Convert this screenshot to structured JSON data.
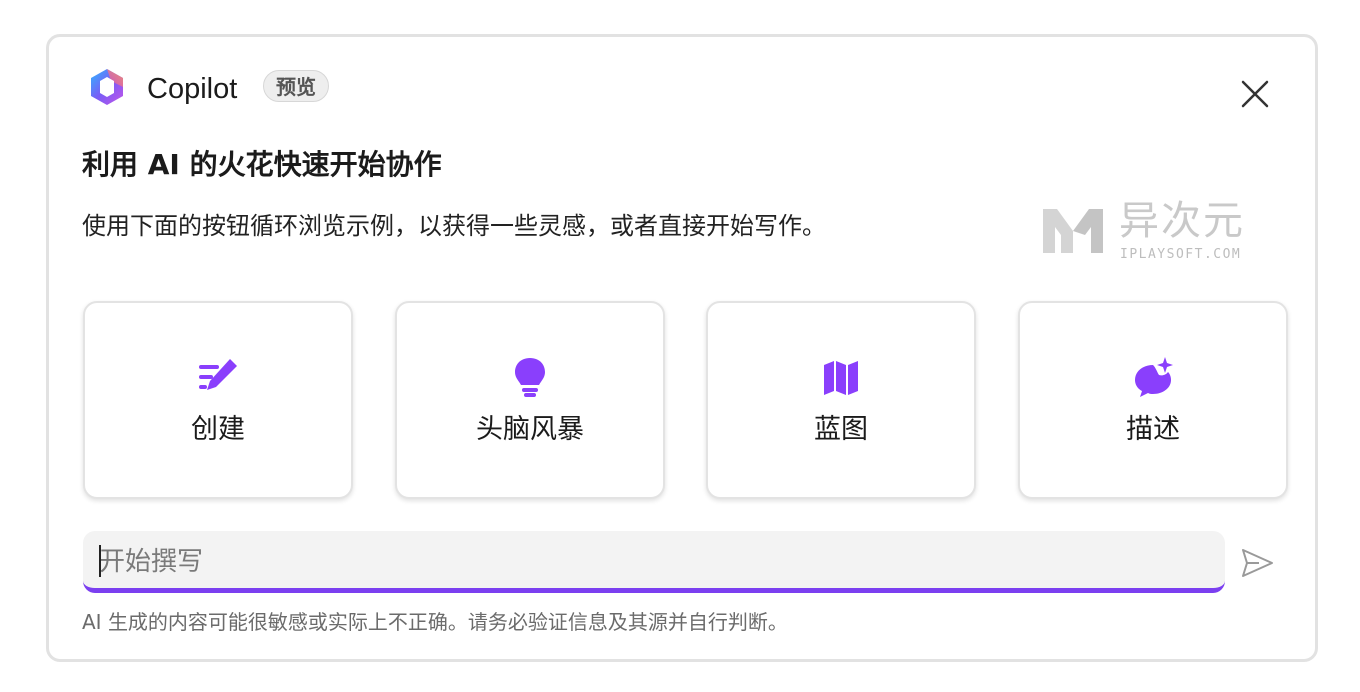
{
  "header": {
    "app_name": "Copilot",
    "badge": "预览",
    "logo_icon": "copilot-logo-icon",
    "close_icon": "close-icon"
  },
  "intro": {
    "heading": "利用 AI 的火花快速开始协作",
    "subtitle": "使用下面的按钮循环浏览示例，以获得一些灵感，或者直接开始写作。"
  },
  "watermark": {
    "text": "异次元",
    "subtext": "IPLAYSOFT.COM"
  },
  "cards": [
    {
      "label": "创建",
      "icon": "pencil-lines-icon"
    },
    {
      "label": "头脑风暴",
      "icon": "lightbulb-icon"
    },
    {
      "label": "蓝图",
      "icon": "map-icon"
    },
    {
      "label": "描述",
      "icon": "chat-sparkle-icon"
    }
  ],
  "composer": {
    "placeholder": "开始撰写",
    "value": "",
    "send_icon": "send-icon"
  },
  "disclaimer": "AI 生成的内容可能很敏感或实际上不正确。请务必验证信息及其源并自行判断。",
  "colors": {
    "accent": "#7b3ff0",
    "icon_purple": "#8a3ffc",
    "panel_border": "#e2e2e2",
    "input_bg": "#f3f3f3"
  }
}
